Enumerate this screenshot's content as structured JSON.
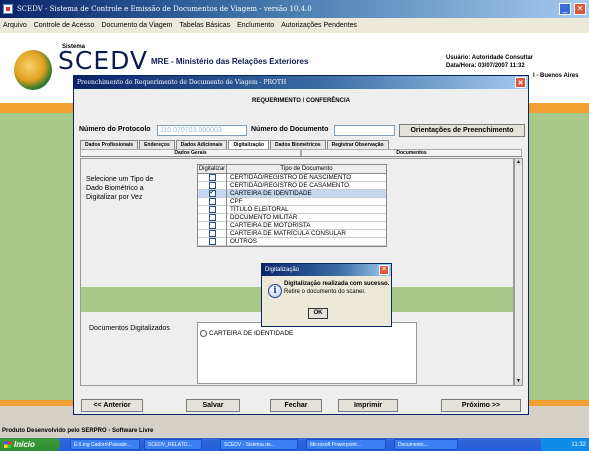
{
  "app": {
    "title": "SCEDV - Sistema de Controle e Emissão de Documentos de Viagem - versão 10.4.0",
    "min_glyph": "_",
    "close_glyph": "✕"
  },
  "menu": [
    "Arquivo",
    "Controle de Acesso",
    "Documento da Viagem",
    "Tabelas Básicas",
    "Enclumento",
    "Autorizações Pendentes"
  ],
  "header": {
    "sistema": "Sistema",
    "scedv": "SCEDV",
    "org": "MRE - Ministério das Relações Exteriores",
    "user_line": "Usuário:   Autoridade Consultar",
    "date_line": "Data/Hora: 03/07/2007 11:32",
    "location_tail": "l - Buenos Aires"
  },
  "inner": {
    "title": "Preenchimento do Requerimento de Documento de Viagem - PROTH",
    "close_glyph": "✕",
    "req_title": "REQUERIMENTO / CONFERÊNCIA",
    "protocol_label": "Número do Protocolo",
    "protocol_value": "110.070703.000003",
    "document_label": "Número do Documento",
    "orient_button": "Orientações de Preenchimento",
    "tabs": [
      "Dados Profissionais",
      "Endereços",
      "Dados Adicionais",
      "Digitalização",
      "Dados Biométricos",
      "Registrar Observação"
    ],
    "active_tab": "Digitalização",
    "subtabs": [
      "Dados Gerais",
      "Documentos"
    ],
    "select_label": "Selecione um Tipo de Dado Biométrico a Digitalizar por Vez",
    "table_head_dig": "Digitalizar",
    "table_head_tipo": "Tipo de Documento",
    "documents": [
      {
        "name": "CERTIDÃO/REGISTRO DE NASCIMENTO",
        "checked": false
      },
      {
        "name": "CERTIDÃO/REGISTRO DE CASAMENTO",
        "checked": false
      },
      {
        "name": "CARTEIRA DE IDENTIDADE",
        "checked": true
      },
      {
        "name": "CPF",
        "checked": false
      },
      {
        "name": "TÍTULO ELEITORAL",
        "checked": false
      },
      {
        "name": "DOCUMENTO MILITAR",
        "checked": false
      },
      {
        "name": "CARTEIRA DE MOTORISTA",
        "checked": false
      },
      {
        "name": "CARTEIRA DE MATRÍCULA CONSULAR",
        "checked": false
      },
      {
        "name": "OUTROS",
        "checked": false
      }
    ],
    "check_glyph": "✔",
    "digitalized_label": "Documentos Digitalizados",
    "digitalized_items": [
      "CARTEIRA DE IDENTIDADE"
    ],
    "nav": {
      "prev": "<< Anterior",
      "save": "Salvar",
      "close": "Fechar",
      "print": "Imprimir",
      "next": "Próximo >>"
    },
    "scroll_up": "▲",
    "scroll_down": "▼"
  },
  "dialog": {
    "title": "Digitalização",
    "close_glyph": "✕",
    "icon_glyph": "i",
    "message": "Digitalização realizada com sucesso.",
    "sub_message": "Retire o documento do scaner.",
    "ok": "OK"
  },
  "footer": "Produto Desenvolvido pelo SERPRO - Software Livre",
  "taskbar": {
    "start": "Início",
    "items": [
      "E:\\Ling Cadorn\\Passabr...",
      "SCEDV_RELATO...",
      "SCEDV - Sistema de...",
      "Microsoft Powerpoint...",
      "Documento..."
    ],
    "tray": "11:32"
  },
  "colors": {
    "accent": "#0a246a",
    "orange_band": "#f0a030",
    "green_bg": "#a9c98a"
  }
}
